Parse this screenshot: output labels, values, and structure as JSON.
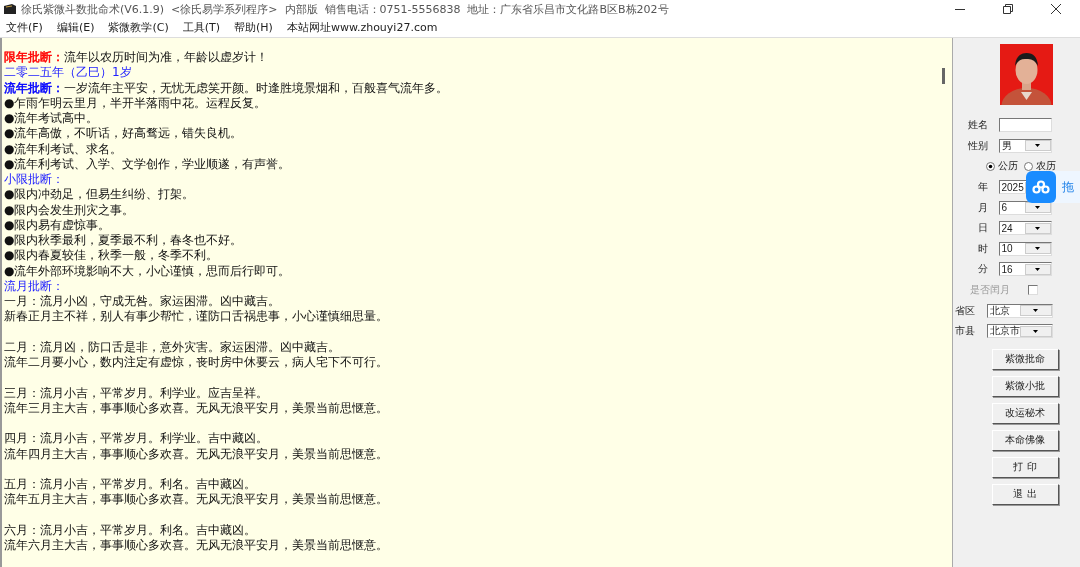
{
  "window": {
    "title": "徐氏紫微斗数批命术(V6.1.9)  <徐氏易学系列程序>  内部版  销售电话：0751-5556838  地址：广东省乐昌市文化路B区B栋202号"
  },
  "menu": [
    "文件(F)",
    "编辑(E)",
    "紫微教学(C)",
    "工具(T)",
    "帮助(H)",
    "本站网址www.zhouyi27.com"
  ],
  "report": [
    {
      "kind": "labeled",
      "label": "限年批断：",
      "color": "#ff0000",
      "text": "流年以农历时间为准，年龄以虚岁计！"
    },
    {
      "kind": "heading",
      "text": "二零二五年（乙巳）1岁"
    },
    {
      "kind": "labeled",
      "label": "流年批断：",
      "color": "#0000ff",
      "text": "一岁流年主平安，无忧无虑笑开颜。时逢胜境景烟和，百般喜气流年多。"
    },
    {
      "kind": "text",
      "text": "●乍雨乍明云里月，半开半落雨中花。运程反复。"
    },
    {
      "kind": "text",
      "text": "●流年考试高中。"
    },
    {
      "kind": "text",
      "text": "●流年高傲，不听话，好高骛远，错失良机。"
    },
    {
      "kind": "text",
      "text": "●流年利考试、求名。"
    },
    {
      "kind": "text",
      "text": "●流年利考试、入学、文学创作，学业顺遂，有声誉。"
    },
    {
      "kind": "heading",
      "text": "小限批断："
    },
    {
      "kind": "text",
      "text": "●限内冲劲足，但易生纠纷、打架。"
    },
    {
      "kind": "text",
      "text": "●限内会发生刑灾之事。"
    },
    {
      "kind": "text",
      "text": "●限内易有虚惊事。"
    },
    {
      "kind": "text",
      "text": "●限内秋季最利，夏季最不利，春冬也不好。"
    },
    {
      "kind": "text",
      "text": "●限内春夏较佳，秋季一般，冬季不利。"
    },
    {
      "kind": "text",
      "text": "●流年外部环境影响不大，小心谨慎，思而后行即可。"
    },
    {
      "kind": "heading",
      "text": "流月批断："
    },
    {
      "kind": "text",
      "text": "一月：流月小凶，守成无咎。家运困滞。凶中藏吉。"
    },
    {
      "kind": "text",
      "text": "新春正月主不祥，别人有事少帮忙，谨防口舌祸患事，小心谨慎细思量。"
    },
    {
      "kind": "blank"
    },
    {
      "kind": "text",
      "text": "二月：流月凶，防口舌是非，意外灾害。家运困滞。凶中藏吉。"
    },
    {
      "kind": "text",
      "text": "流年二月要小心，数内注定有虚惊，丧时房中休要云，病人宅下不可行。"
    },
    {
      "kind": "blank"
    },
    {
      "kind": "text",
      "text": "三月：流月小吉，平常岁月。利学业。应吉呈祥。"
    },
    {
      "kind": "text",
      "text": "流年三月主大吉，事事顺心多欢喜。无风无浪平安月，美景当前思惬意。"
    },
    {
      "kind": "blank"
    },
    {
      "kind": "text",
      "text": "四月：流月小吉，平常岁月。利学业。吉中藏凶。"
    },
    {
      "kind": "text",
      "text": "流年四月主大吉，事事顺心多欢喜。无风无浪平安月，美景当前思惬意。"
    },
    {
      "kind": "blank"
    },
    {
      "kind": "text",
      "text": "五月：流月小吉，平常岁月。利名。吉中藏凶。"
    },
    {
      "kind": "text",
      "text": "流年五月主大吉，事事顺心多欢喜。无风无浪平安月，美景当前思惬意。"
    },
    {
      "kind": "blank"
    },
    {
      "kind": "text",
      "text": "六月：流月小吉，平常岁月。利名。吉中藏凶。"
    },
    {
      "kind": "text",
      "text": "流年六月主大吉，事事顺心多欢喜。无风无浪平安月，美景当前思惬意。"
    }
  ],
  "form": {
    "fields": [
      {
        "kind": "input",
        "label": "姓名"
      },
      {
        "kind": "select",
        "label": "性别",
        "value": "男"
      },
      {
        "kind": "radios",
        "options": [
          {
            "label": "公历",
            "selected": true
          },
          {
            "label": "农历",
            "selected": false
          }
        ]
      },
      {
        "kind": "select",
        "label": "年",
        "value": "2025"
      },
      {
        "kind": "select",
        "label": "月",
        "value": "6"
      },
      {
        "kind": "select",
        "label": "日",
        "value": "24"
      },
      {
        "kind": "select",
        "label": "时",
        "value": "10"
      },
      {
        "kind": "select",
        "label": "分",
        "value": "16"
      },
      {
        "kind": "checkbox",
        "label": "是否闰月",
        "checked": false,
        "disabled": true
      },
      {
        "kind": "select",
        "label": "省区",
        "value": "北京"
      },
      {
        "kind": "select",
        "label": "市县",
        "value": "北京市"
      }
    ],
    "buttons": [
      "紫微批命",
      "紫微小批",
      "改运秘术",
      "本命佛像",
      "打 印",
      "退 出"
    ]
  },
  "floating_widget": {
    "label": "拖"
  }
}
